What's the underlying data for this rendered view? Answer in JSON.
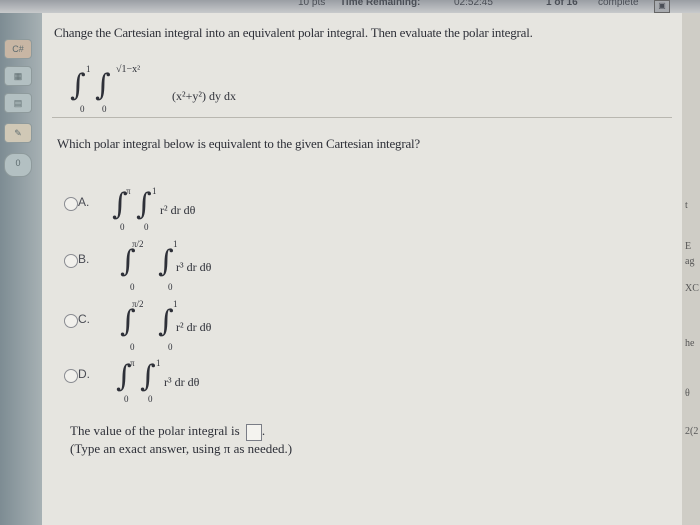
{
  "topbar": {
    "points": "10 pts",
    "time_label": "Time Remaining:",
    "time_value": "02:52:45",
    "question_counter": "1 of 16",
    "status": "complete"
  },
  "sidebar": {
    "icons": [
      "back-icon",
      "grid-icon",
      "calculator-icon",
      "notes-icon",
      "help-icon"
    ],
    "labels": [
      "C#",
      "",
      "",
      "",
      "0"
    ]
  },
  "problem": {
    "instruction": "Change the Cartesian integral into an equivalent polar integral. Then evaluate the polar integral.",
    "integral": {
      "outer_upper": "1",
      "outer_lower": "0",
      "inner_upper": "√1−x²",
      "inner_lower": "0",
      "integrand": "(x²+y²) dy dx"
    },
    "question": "Which polar integral below is equivalent to the given Cartesian integral?"
  },
  "options": [
    {
      "label": "A.",
      "outer_upper": "π",
      "outer_lower": "0",
      "inner_upper": "1",
      "inner_lower": "0",
      "integrand": "r² dr dθ"
    },
    {
      "label": "B.",
      "outer_upper": "π/2",
      "outer_lower": "0",
      "inner_upper": "1",
      "inner_lower": "0",
      "integrand": "r³ dr dθ"
    },
    {
      "label": "C.",
      "outer_upper": "π/2",
      "outer_lower": "0",
      "inner_upper": "1",
      "inner_lower": "0",
      "integrand": "r² dr dθ"
    },
    {
      "label": "D.",
      "outer_upper": "π",
      "outer_lower": "0",
      "inner_upper": "1",
      "inner_lower": "0",
      "integrand": "r³ dr dθ"
    }
  ],
  "answer": {
    "prompt": "The value of the polar integral is",
    "input_value": "",
    "note": "(Type an exact answer, using π as needed.)"
  },
  "right_edge": [
    "t",
    "E",
    "ag",
    "XC",
    "he",
    "θ",
    "2(2"
  ]
}
